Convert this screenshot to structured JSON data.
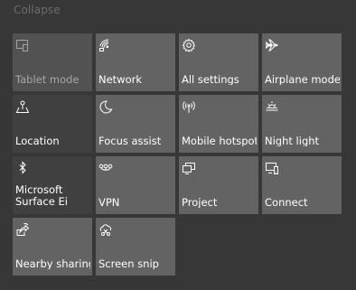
{
  "header": {
    "collapse_label": "Collapse"
  },
  "tiles": [
    {
      "label": "Tablet mode",
      "icon": "tablet-mode-icon"
    },
    {
      "label": "Network",
      "icon": "network-icon"
    },
    {
      "label": "All settings",
      "icon": "gear-icon"
    },
    {
      "label": "Airplane mode",
      "icon": "airplane-icon"
    },
    {
      "label": "Location",
      "icon": "location-icon"
    },
    {
      "label": "Focus assist",
      "icon": "moon-icon"
    },
    {
      "label": "Mobile hotspot",
      "icon": "hotspot-icon"
    },
    {
      "label": "Night light",
      "icon": "sun-icon"
    },
    {
      "label": "Microsoft Surface Ei",
      "icon": "bluetooth-icon"
    },
    {
      "label": "VPN",
      "icon": "vpn-icon"
    },
    {
      "label": "Project",
      "icon": "project-icon"
    },
    {
      "label": "Connect",
      "icon": "connect-icon"
    },
    {
      "label": "Nearby sharing",
      "icon": "nearby-sharing-icon"
    },
    {
      "label": "Screen snip",
      "icon": "screen-snip-icon"
    }
  ],
  "colors": {
    "background": "#373737",
    "tile_active": "#636363",
    "tile_off": "#404040",
    "tile_disabled": "#525252",
    "text": "#ffffff",
    "text_disabled": "#a6a6a6"
  }
}
